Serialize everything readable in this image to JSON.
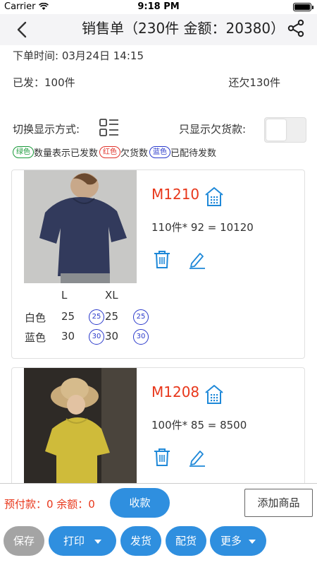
{
  "status": {
    "carrier": "Carrier",
    "time": "9:18 PM"
  },
  "header": {
    "title": "销售单（230件 金额：20380）"
  },
  "order": {
    "time": "下单时间: 03月24日 14:15",
    "shipped": "已发：100件",
    "owed": "还欠130件"
  },
  "controls": {
    "display_mode_label": "切换显示方式:",
    "owed_only_label": "只显示欠货款:",
    "owed_only_on": false
  },
  "legend": {
    "green_pill": "绿色",
    "green_text": "数量表示已发数",
    "red_pill": "红色",
    "red_text": "欠货数",
    "blue_pill": "蓝色",
    "blue_text": "已配待发数"
  },
  "products": [
    {
      "code": "M1210",
      "calc": "110件* 92 = 10120",
      "sizes": [
        "L",
        "XL"
      ],
      "rows": [
        {
          "color": "白色",
          "values": [
            "25",
            "25"
          ],
          "badges": [
            "25",
            "25"
          ]
        },
        {
          "color": "蓝色",
          "values": [
            "30",
            "30"
          ],
          "badges": [
            "30",
            "30"
          ]
        }
      ]
    },
    {
      "code": "M1208",
      "calc": "100件* 85 = 8500"
    }
  ],
  "footer": {
    "prepay": "预付款：0 余额：0",
    "collect": "收款",
    "add_product": "添加商品",
    "save": "保存",
    "print": "打印",
    "ship": "发货",
    "allocate": "配货",
    "more": "更多"
  },
  "colors": {
    "accent": "#2f8fdf",
    "red": "#e8371b",
    "icon_blue": "#1e88d8"
  }
}
